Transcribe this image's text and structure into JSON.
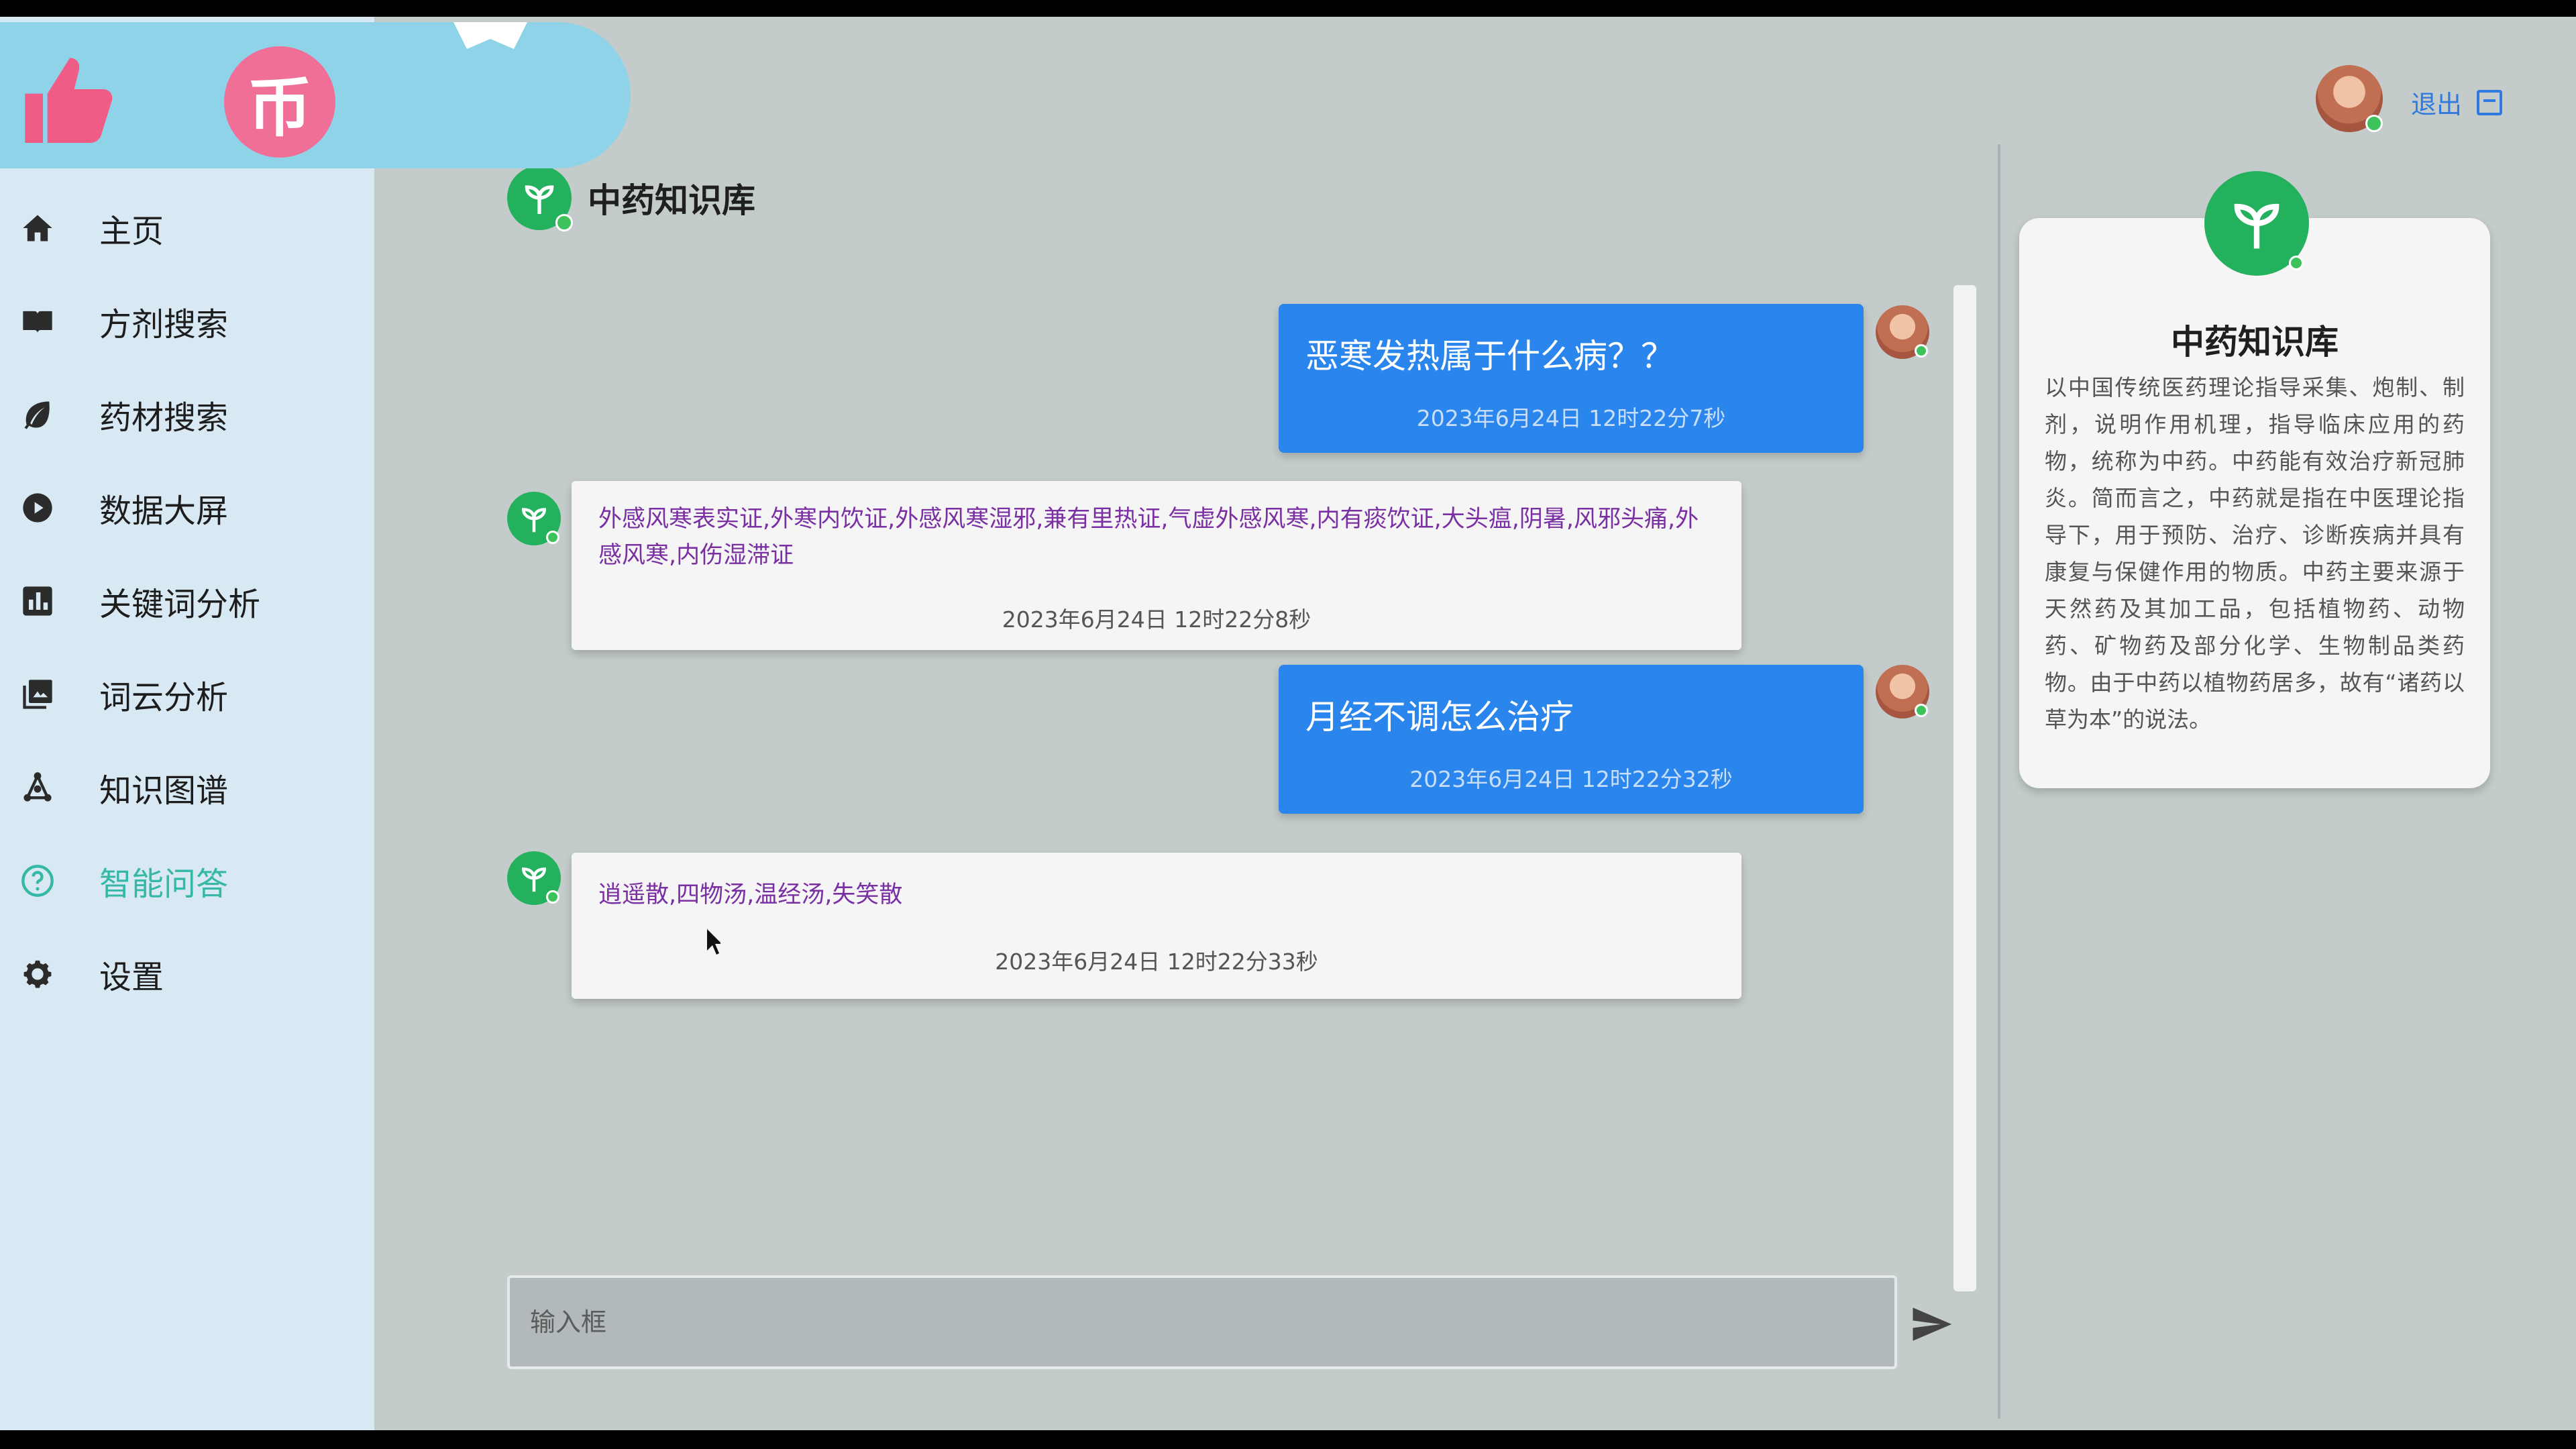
{
  "sidebar": {
    "items": [
      {
        "label": "主页",
        "icon": "home-icon"
      },
      {
        "label": "方剂搜索",
        "icon": "book-icon"
      },
      {
        "label": "药材搜索",
        "icon": "leaf-icon"
      },
      {
        "label": "数据大屏",
        "icon": "play-icon"
      },
      {
        "label": "关键词分析",
        "icon": "bar-chart-icon"
      },
      {
        "label": "词云分析",
        "icon": "image-stack-icon"
      },
      {
        "label": "知识图谱",
        "icon": "graph-icon"
      },
      {
        "label": "智能问答",
        "icon": "question-icon"
      },
      {
        "label": "设置",
        "icon": "gear-icon"
      }
    ],
    "active_index": 7
  },
  "overlay": {
    "coin_glyph": "币"
  },
  "header": {
    "logout": "退出"
  },
  "chat": {
    "title": "中药知识库",
    "messages": [
      {
        "role": "user",
        "text": "恶寒发热属于什么病？？",
        "time": "2023年6月24日 12时22分7秒"
      },
      {
        "role": "bot",
        "text": "外感风寒表实证,外寒内饮证,外感风寒湿邪,兼有里热证,气虚外感风寒,内有痰饮证,大头瘟,阴暑,风邪头痛,外感风寒,内伤湿滞证",
        "time": "2023年6月24日 12时22分8秒"
      },
      {
        "role": "user",
        "text": "月经不调怎么治疗",
        "time": "2023年6月24日 12时22分32秒"
      },
      {
        "role": "bot",
        "text": "逍遥散,四物汤,温经汤,失笑散",
        "time": "2023年6月24日 12时22分33秒"
      }
    ],
    "input_placeholder": "输入框"
  },
  "info": {
    "title": "中药知识库",
    "description": "以中国传统医药理论指导采集、炮制、制剂，说明作用机理，指导临床应用的药物，统称为中药。中药能有效治疗新冠肺炎。简而言之，中药就是指在中医理论指导下，用于预防、治疗、诊断疾病并具有康复与保健作用的物质。中药主要来源于天然药及其加工品，包括植物药、动物药、矿物药及部分化学、生物制品类药物。由于中药以植物药居多，故有“诸药以草为本”的说法。"
  },
  "colors": {
    "accent": "#2a86ed",
    "active_nav": "#35b8a6",
    "bot_green": "#23b15d",
    "bot_text": "#7a2fa3"
  }
}
